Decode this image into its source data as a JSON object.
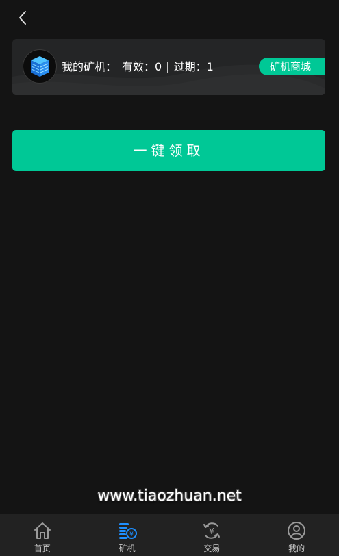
{
  "header": {
    "back_icon": "chevron-left-icon"
  },
  "miner_card": {
    "avatar_icon": "server-stack-icon",
    "label": "我的矿机：",
    "valid_label": "有效：",
    "valid_count": "0",
    "separator": "|",
    "expired_label": "过期：",
    "expired_count": "1",
    "shop_button": "矿机商城"
  },
  "claim_button": "一键领取",
  "watermark": "www.tiaozhuan.net",
  "tabbar": {
    "items": [
      {
        "label": "首页",
        "icon": "home-icon",
        "active": false
      },
      {
        "label": "矿机",
        "icon": "miner-coin-icon",
        "active": true
      },
      {
        "label": "交易",
        "icon": "yen-exchange-icon",
        "active": false
      },
      {
        "label": "我的",
        "icon": "user-icon",
        "active": false
      }
    ]
  },
  "colors": {
    "accent": "#00c896",
    "background": "#141414",
    "card": "#242526",
    "tabbar": "#222222",
    "active_icon": "#1e8fff",
    "inactive_icon": "#9a9a9a"
  }
}
